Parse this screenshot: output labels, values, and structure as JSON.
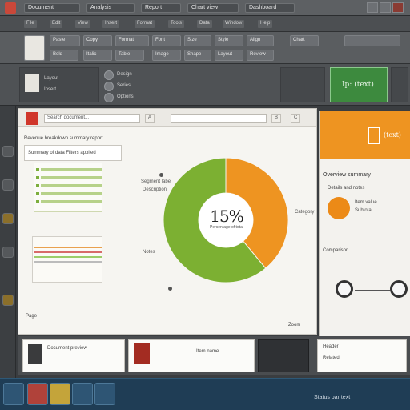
{
  "titlebar": {
    "tabs": [
      "Document",
      "Analysis",
      "Report",
      "Chart view",
      "Dashboard"
    ]
  },
  "menu": {
    "items": [
      "File",
      "Edit",
      "View",
      "Insert",
      "Format",
      "Tools",
      "Data",
      "Window",
      "Help"
    ]
  },
  "ribbon": {
    "row1": [
      "Paste",
      "Copy",
      "Format",
      "Font",
      "Size",
      "Style",
      "Align",
      "Chart"
    ],
    "row2": [
      "Bold",
      "Italic",
      "Table",
      "Image",
      "Shape",
      "Layout",
      "Review"
    ]
  },
  "toolbar2": {
    "labels": [
      "Layout",
      "Insert",
      "Design",
      "Series",
      "Options"
    ],
    "green_label": "Ip: (text)"
  },
  "document": {
    "search_value": "Search document...",
    "chips": [
      "A",
      "B",
      "C"
    ],
    "heading": "Revenue breakdown summary report",
    "info": "Summary of data  Filters applied",
    "callouts": [
      "Segment label",
      "Description",
      "Category",
      "Notes"
    ],
    "center_value": "15%",
    "center_label": "Percentage of total",
    "footer_items": [
      "Page",
      "Zoom"
    ]
  },
  "chart_data": {
    "type": "pie",
    "categories": [
      "Orange",
      "Green"
    ],
    "values": [
      39,
      61
    ],
    "title": ""
  },
  "right_panel": {
    "banner_text": "(text)",
    "title": "Overview summary",
    "items": [
      "Details and notes",
      "Item value",
      "Subtotal",
      "Comparison"
    ]
  },
  "lower": {
    "cards": [
      "Document preview",
      "Item name",
      "Header",
      "Related"
    ]
  },
  "taskbar": {
    "label": "Status bar text"
  },
  "colors": {
    "orange": "#ee9421",
    "green": "#7cb032",
    "accent_red": "#d0362b"
  }
}
